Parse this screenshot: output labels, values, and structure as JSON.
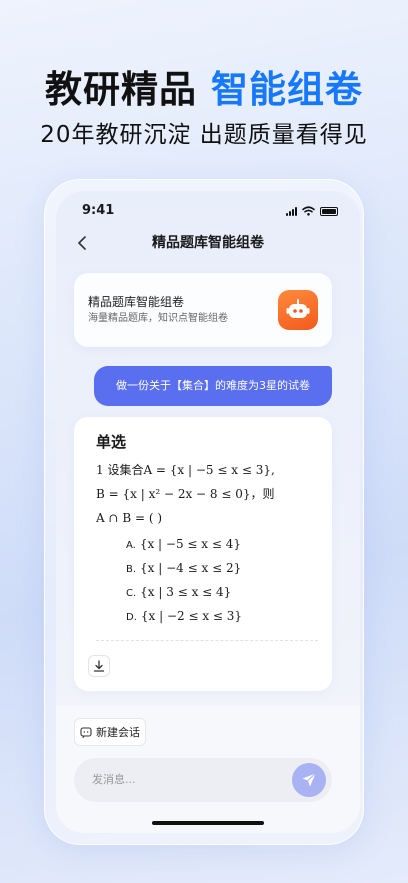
{
  "headline": {
    "part1": "教研精品",
    "part2": "智能组卷"
  },
  "subline": "20年教研沉淀 出题质量看得见",
  "status": {
    "time": "9:41"
  },
  "nav": {
    "title": "精品题库智能组卷"
  },
  "intro": {
    "title": "精品题库智能组卷",
    "subtitle": "海量精品题库，知识点智能组卷",
    "icon": "robot-icon"
  },
  "user_message": "做一份关于【集合】的难度为3星的试卷",
  "question": {
    "type": "单选",
    "line1": "1  设集合A = {x | −5 ≤ x ≤ 3},",
    "line2": "B = {x | x² − 2x − 8 ≤ 0}，则",
    "line3": "A ∩ B = (    )",
    "options": [
      {
        "letter": "A.",
        "text": "{x | −5 ≤ x ≤ 4}"
      },
      {
        "letter": "B.",
        "text": "{x | −4 ≤ x ≤ 2}"
      },
      {
        "letter": "C.",
        "text": "{x | 3 ≤ x ≤ 4}"
      },
      {
        "letter": "D.",
        "text": "{x | −2 ≤ x ≤ 3}"
      }
    ]
  },
  "bottom": {
    "new_chat": "新建会话",
    "input_placeholder": "发消息..."
  },
  "colors": {
    "accent_blue": "#1677ff",
    "bubble": "#5a6ff0",
    "robot_orange": "#f25a1c",
    "send": "#a9b2f3"
  }
}
